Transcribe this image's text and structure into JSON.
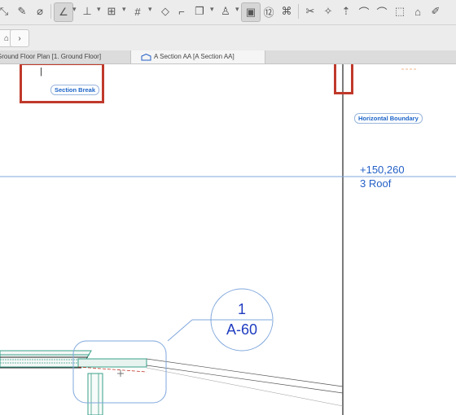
{
  "toolbar": {
    "tools": [
      {
        "name": "pointer-arrow-icon",
        "glyph": "⤡"
      },
      {
        "name": "pen-icon",
        "glyph": "✎"
      },
      {
        "name": "eyedropper-icon",
        "glyph": "⌀"
      },
      {
        "name": "angle-icon",
        "glyph": "∠"
      },
      {
        "name": "guide-line-icon",
        "glyph": "⊥"
      },
      {
        "name": "snap-grid-icon",
        "glyph": "⊞"
      },
      {
        "name": "grid-icon",
        "glyph": "#"
      },
      {
        "name": "layer-icon",
        "glyph": "◇"
      },
      {
        "name": "stair-icon",
        "glyph": "⌐"
      },
      {
        "name": "copy-icon",
        "glyph": "❐"
      },
      {
        "name": "lamp-icon",
        "glyph": "♙"
      },
      {
        "name": "show-hide-icon",
        "glyph": "▣"
      },
      {
        "name": "scale-icon",
        "glyph": "⑫"
      },
      {
        "name": "split-icon",
        "glyph": "⌘"
      },
      {
        "name": "scissors-icon",
        "glyph": "✂"
      },
      {
        "name": "magic-wand-icon",
        "glyph": "✧"
      },
      {
        "name": "offset-icon",
        "glyph": "⇡"
      },
      {
        "name": "fillet-icon",
        "glyph": "⌒"
      },
      {
        "name": "stretch-icon",
        "glyph": "⬚"
      },
      {
        "name": "house-icon",
        "glyph": "⌂"
      },
      {
        "name": "edit-icon",
        "glyph": "✐"
      }
    ]
  },
  "nav": {
    "home_glyph": "⌂",
    "forward_glyph": "›"
  },
  "tabs": [
    {
      "label": "Ground Floor Plan [1. Ground Floor]",
      "active": false
    },
    {
      "label": "A Section AA [A Section AA]",
      "active": true
    }
  ],
  "canvas": {
    "section_break_label": "Section Break",
    "horizontal_boundary_label": "Horizontal Boundary",
    "level_elevation": "+150,260",
    "level_name": "3 Roof",
    "marker_number": "1",
    "marker_sheet": "A-60",
    "cursor_glyph": "|"
  },
  "colors": {
    "highlight_red": "#c0392b",
    "annotation_blue": "#2460c6",
    "marker_blue": "#1f3cc0",
    "building_green": "#3aa08a"
  }
}
